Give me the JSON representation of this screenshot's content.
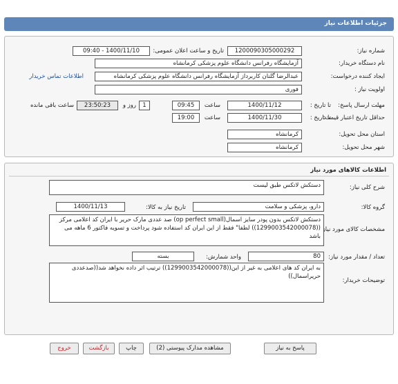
{
  "header": {
    "title": "جزئیات اطلاعات نیاز"
  },
  "form": {
    "need_number_label": "شماره نیاز:",
    "need_number": "1200090305000292",
    "announce_label": "تاریخ و ساعت اعلان عمومی:",
    "announce_value": "1400/11/10 - 09:40",
    "buyer_org_label": "نام دستگاه خریدار:",
    "buyer_org": "آزمایشگاه رفرانس دانشگاه علوم پزشکی کرمانشاه",
    "creator_label": "ایجاد کننده درخواست:",
    "creator": "عبدالرضا گلنان کاربرداز آزمایشگاه رفرانس دانشگاه علوم پزشکی کرمانشاه",
    "contact_link": "اطلاعات تماس خریدار",
    "priority_label": "اولویت نیاز :",
    "priority": "فوری",
    "deadline_label": "مهلت ارسال پاسخ:",
    "to_date_label": "تا تاریخ :",
    "deadline_date": "1400/11/12",
    "time_label": "ساعت",
    "deadline_time": "09:45",
    "days_value": "1",
    "days_label": "روز و",
    "remaining_time": "23:50:23",
    "remaining_label": "ساعت باقی مانده",
    "price_validity_label": "حداقل تاریخ اعتبار قیمت:",
    "validity_date": "1400/11/30",
    "validity_time": "19:00",
    "province_label": "استان محل تحویل:",
    "province": "کرمانشاه",
    "city_label": "شهر محل تحویل:",
    "city": "کرمانشاه"
  },
  "goods": {
    "section_title": "اطلاعات کالاهای مورد نیاز",
    "summary_label": "شرح کلی نیاز:",
    "summary": "دستکش لاتکس طبق لیست",
    "group_label": "گروه کالا:",
    "group": "دارو، پزشکی و سلامت",
    "need_date_label": "تاریخ نیاز به کالا:",
    "need_date": "1400/11/13",
    "spec_label": "مشخصات کالای مورد نیاز:",
    "spec": "دستکش لاتکس بدون پودر سایز اسمال(op perfect small) صد عددی مارک حریر با ایران کد اعلامی مرکز ((1299003542000078)) لطفا\" فقط از این ایران کد استفاده شود پرداخت و تسویه فاکتور 6 ماهه می باشد",
    "qty_label": "تعداد / مقدار مورد نیاز:",
    "qty": "80",
    "unit_label": "واحد شمارش:",
    "unit": "بسته",
    "buyer_notes_label": "توضیحات خریدار:",
    "buyer_notes": "به ایران کد های اعلامی به غیر از این((1299003542000078)) ترتیب اثر داده نخواهد شد((صدعددی حریراسمال))"
  },
  "buttons": {
    "reply": "پاسخ به نیاز",
    "attachments": "مشاهده مدارک پیوستی (2)",
    "print": "چاپ",
    "back": "بازگشت",
    "exit": "خروج"
  }
}
